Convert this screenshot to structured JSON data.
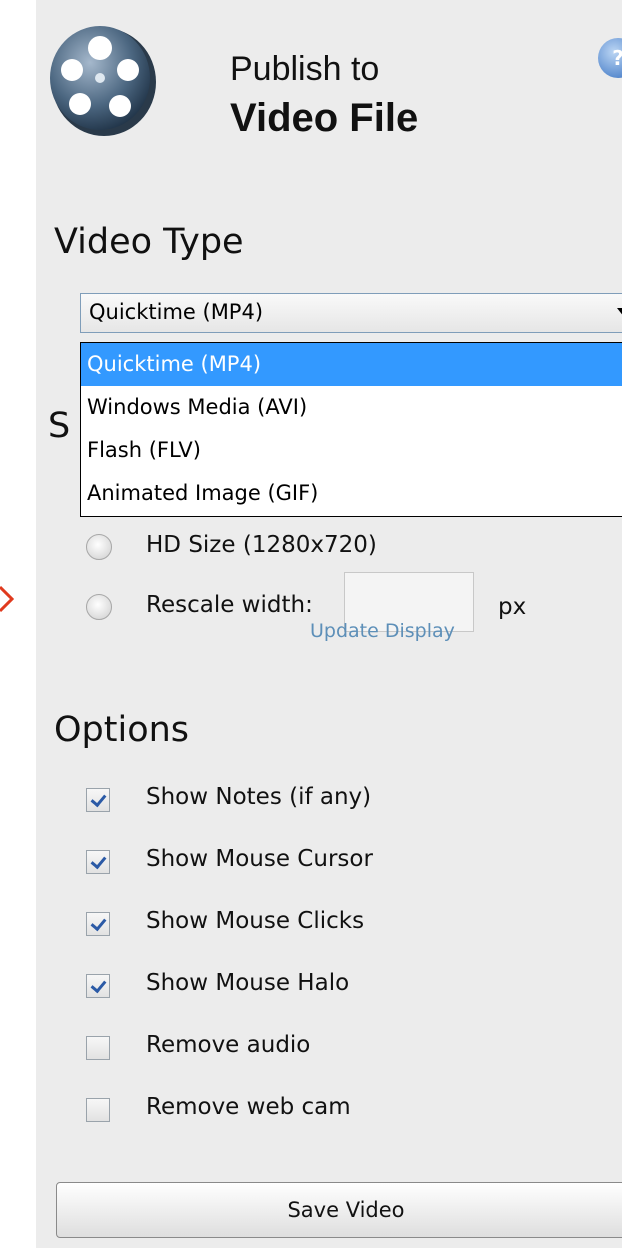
{
  "header": {
    "title_line1": "Publish to",
    "title_line2": "Video File",
    "help_glyph": "?"
  },
  "video_type": {
    "section_title": "Video Type",
    "selected_value": "Quicktime (MP4)",
    "options": [
      "Quicktime (MP4)",
      "Windows Media (AVI)",
      "Flash (FLV)",
      "Animated Image (GIF)"
    ]
  },
  "size": {
    "section_title_partial": "S",
    "hd_label": "HD Size (1280x720)",
    "rescale_label": "Rescale width:",
    "rescale_value": "",
    "unit": "px",
    "update_link": "Update Display"
  },
  "options": {
    "section_title": "Options",
    "items": [
      {
        "label": "Show Notes (if any)",
        "checked": true
      },
      {
        "label": "Show Mouse Cursor",
        "checked": true
      },
      {
        "label": "Show Mouse Clicks",
        "checked": true
      },
      {
        "label": "Show Mouse Halo",
        "checked": true
      },
      {
        "label": "Remove audio",
        "checked": false
      },
      {
        "label": "Remove web cam",
        "checked": false
      }
    ]
  },
  "footer": {
    "save_label": "Save Video"
  },
  "colors": {
    "panel_bg": "#ececec",
    "selection_blue": "#3399ff",
    "link_blue": "#5d8fb8",
    "check_blue": "#2b5aa6",
    "annotation_red": "#e03a1e"
  },
  "icons": [
    "film-reel-icon",
    "help-icon",
    "dropdown-arrow-icon",
    "checkmark-icon"
  ]
}
